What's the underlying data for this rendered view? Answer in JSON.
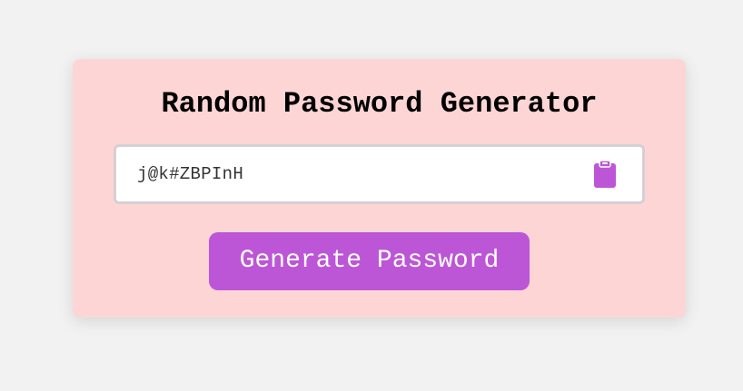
{
  "app": {
    "title": "Random Password Generator"
  },
  "password": {
    "value": "j@k#ZBPInH"
  },
  "actions": {
    "generate_label": "Generate Password",
    "copy_icon": "clipboard-icon"
  },
  "colors": {
    "background": "#f2f2f2",
    "card": "#fed5d5",
    "accent": "#bc56d6",
    "field_border": "#d4d0d4"
  }
}
